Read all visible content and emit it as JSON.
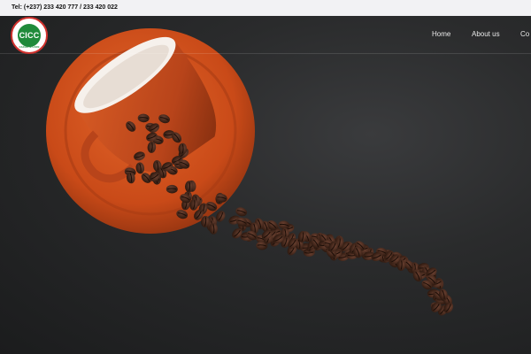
{
  "topbar": {
    "phone_text": "Tel: (+237) 233 420 777 / 233 420 022"
  },
  "logo": {
    "initials": "CICC",
    "subtitle": "CACAO & CAFE"
  },
  "nav": {
    "items": [
      {
        "label": "Home"
      },
      {
        "label": "About us"
      },
      {
        "label": "Co"
      }
    ]
  },
  "colors": {
    "saucer": "#d2541f",
    "cup": "#c4491a",
    "bean": "#3b2417",
    "background": "#2a2b2c",
    "logo_green": "#1f8a3a",
    "logo_red": "#d0312d"
  }
}
